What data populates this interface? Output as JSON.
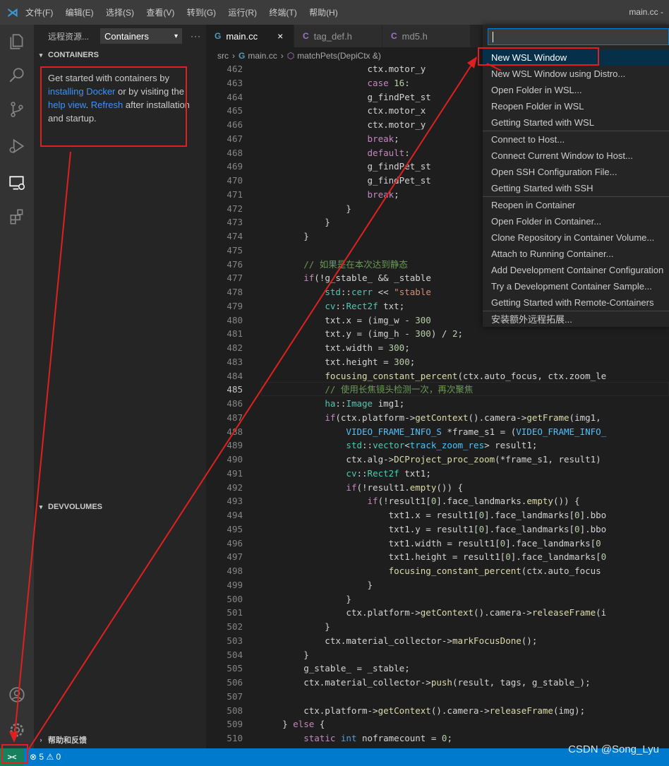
{
  "titlebar": {
    "menu": [
      "文件(F)",
      "编辑(E)",
      "选择(S)",
      "查看(V)",
      "转到(G)",
      "运行(R)",
      "终端(T)",
      "帮助(H)"
    ],
    "window_title": "main.cc -"
  },
  "activity_icons": [
    "explorer-icon",
    "search-icon",
    "source-control-icon",
    "run-debug-icon",
    "remote-explorer-icon",
    "extensions-icon",
    "account-icon",
    "settings-gear-icon"
  ],
  "sidebar": {
    "title": "远程资源...",
    "dropdown_value": "Containers",
    "more": "···",
    "section_containers": "CONTAINERS",
    "welcome": {
      "t1": "Get started with containers by ",
      "link1": "installing Docker",
      "t2": " or by visiting the ",
      "link2": "help view",
      "t3": ". ",
      "link3": "Refresh",
      "t4": " after installation and startup."
    },
    "section_devvolumes": "DEVVOLUMES",
    "section_help": "帮助和反馈"
  },
  "tabs": [
    {
      "icon": "G",
      "label": "main.cc",
      "close": "×"
    },
    {
      "icon": "C",
      "label": "tag_def.h"
    },
    {
      "icon": "C",
      "label": "md5.h"
    }
  ],
  "breadcrumb": {
    "folder": "src",
    "file": "main.cc",
    "symbol": "matchPets(DepiCtx &)"
  },
  "editor": {
    "current_line": "485",
    "lines": [
      [
        "462",
        "                    ctx.motor_y"
      ],
      [
        "463",
        "                    case 16:"
      ],
      [
        "464",
        "                    g_findPet_st"
      ],
      [
        "465",
        "                    ctx.motor_x"
      ],
      [
        "466",
        "                    ctx.motor_y"
      ],
      [
        "467",
        "                    break;"
      ],
      [
        "468",
        "                    default:"
      ],
      [
        "469",
        "                    g_findPet_st"
      ],
      [
        "470",
        "                    g_findPet_st"
      ],
      [
        "471",
        "                    break;"
      ],
      [
        "472",
        "                }"
      ],
      [
        "473",
        "            }"
      ],
      [
        "474",
        "        }"
      ],
      [
        "475",
        ""
      ],
      [
        "476",
        "        // 如果是在本次达到静态"
      ],
      [
        "477",
        "        if(!g_stable_ && _stable"
      ],
      [
        "478",
        "            std::cerr << \"stable"
      ],
      [
        "479",
        "            cv::Rect2f txt;"
      ],
      [
        "480",
        "            txt.x = (img_w - 300"
      ],
      [
        "481",
        "            txt.y = (img_h - 300) / 2;"
      ],
      [
        "482",
        "            txt.width = 300;"
      ],
      [
        "483",
        "            txt.height = 300;"
      ],
      [
        "484",
        "            focusing_constant_percent(ctx.auto_focus, ctx.zoom_le"
      ],
      [
        "485",
        "            // 使用长焦镜头检测一次，再次聚焦"
      ],
      [
        "486",
        "            ha::Image img1;"
      ],
      [
        "487",
        "            if(ctx.platform->getContext().camera->getFrame(img1,"
      ],
      [
        "488",
        "                VIDEO_FRAME_INFO_S *frame_s1 = (VIDEO_FRAME_INFO_"
      ],
      [
        "489",
        "                std::vector<track_zoom_res> result1;"
      ],
      [
        "490",
        "                ctx.alg->DCProject_proc_zoom(*frame_s1, result1)"
      ],
      [
        "491",
        "                cv::Rect2f txt1;"
      ],
      [
        "492",
        "                if(!result1.empty()) {"
      ],
      [
        "493",
        "                    if(!result1[0].face_landmarks.empty()) {"
      ],
      [
        "494",
        "                        txt1.x = result1[0].face_landmarks[0].bbo"
      ],
      [
        "495",
        "                        txt1.y = result1[0].face_landmarks[0].bbo"
      ],
      [
        "496",
        "                        txt1.width = result1[0].face_landmarks[0"
      ],
      [
        "497",
        "                        txt1.height = result1[0].face_landmarks[0"
      ],
      [
        "498",
        "                        focusing_constant_percent(ctx.auto_focus"
      ],
      [
        "499",
        "                    }"
      ],
      [
        "500",
        "                }"
      ],
      [
        "501",
        "                ctx.platform->getContext().camera->releaseFrame(i"
      ],
      [
        "502",
        "            }"
      ],
      [
        "503",
        "            ctx.material_collector->markFocusDone();"
      ],
      [
        "504",
        "        }"
      ],
      [
        "505",
        "        g_stable_ = _stable;"
      ],
      [
        "506",
        "        ctx.material_collector->push(result, tags, g_stable_);"
      ],
      [
        "507",
        ""
      ],
      [
        "508",
        "        ctx.platform->getContext().camera->releaseFrame(img);"
      ],
      [
        "509",
        "    } else {"
      ],
      [
        "510",
        "        static int noframecount = 0;"
      ]
    ]
  },
  "palette": {
    "input_value": "",
    "items": [
      "New WSL Window",
      "New WSL Window using Distro...",
      "Open Folder in WSL...",
      "Reopen Folder in WSL",
      "Getting Started with WSL",
      "Connect to Host...",
      "Connect Current Window to Host...",
      "Open SSH Configuration File...",
      "Getting Started with SSH",
      "Reopen in Container",
      "Open Folder in Container...",
      "Clone Repository in Container Volume...",
      "Attach to Running Container...",
      "Add Development Container Configuration",
      "Try a Development Container Sample...",
      "Getting Started with Remote-Containers",
      "安装额外远程拓展..."
    ]
  },
  "statusbar": {
    "remote": "><",
    "errors": "5",
    "warnings": "0"
  },
  "watermark": "CSDN @Song_Lyu"
}
